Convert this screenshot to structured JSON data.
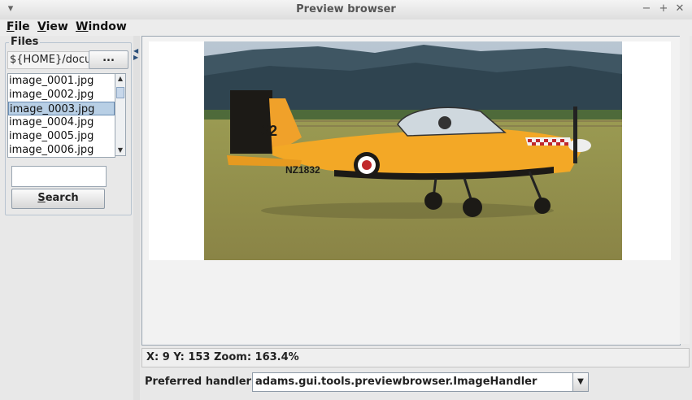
{
  "window": {
    "title": "Preview browser",
    "menu_icon": "chevron-down-icon",
    "minimize_icon": "minimize-icon",
    "maximize_icon": "maximize-icon",
    "close_icon": "close-icon"
  },
  "menubar": {
    "items": [
      {
        "label_first": "F",
        "label_rest": "ile"
      },
      {
        "label_first": "V",
        "label_rest": "iew"
      },
      {
        "label_first": "W",
        "label_rest": "indow"
      }
    ]
  },
  "files": {
    "legend": "Files",
    "directory": "${HOME}/docu",
    "browse_label": "...",
    "list": [
      "image_0001.jpg",
      "image_0002.jpg",
      "image_0003.jpg",
      "image_0004.jpg",
      "image_0005.jpg",
      "image_0006.jpg"
    ],
    "selected_index": 2,
    "search_value": "",
    "search_label_first": "S",
    "search_label_rest": "earch"
  },
  "preview": {
    "image_subject": "orange-propeller-aircraft-on-grass",
    "tail_number": "32",
    "registration": "NZ1832"
  },
  "status": {
    "text": "X: 9   Y: 153   Zoom: 163.4%"
  },
  "handler": {
    "label": "Preferred handler",
    "value": "adams.gui.tools.previewbrowser.ImageHandler"
  }
}
